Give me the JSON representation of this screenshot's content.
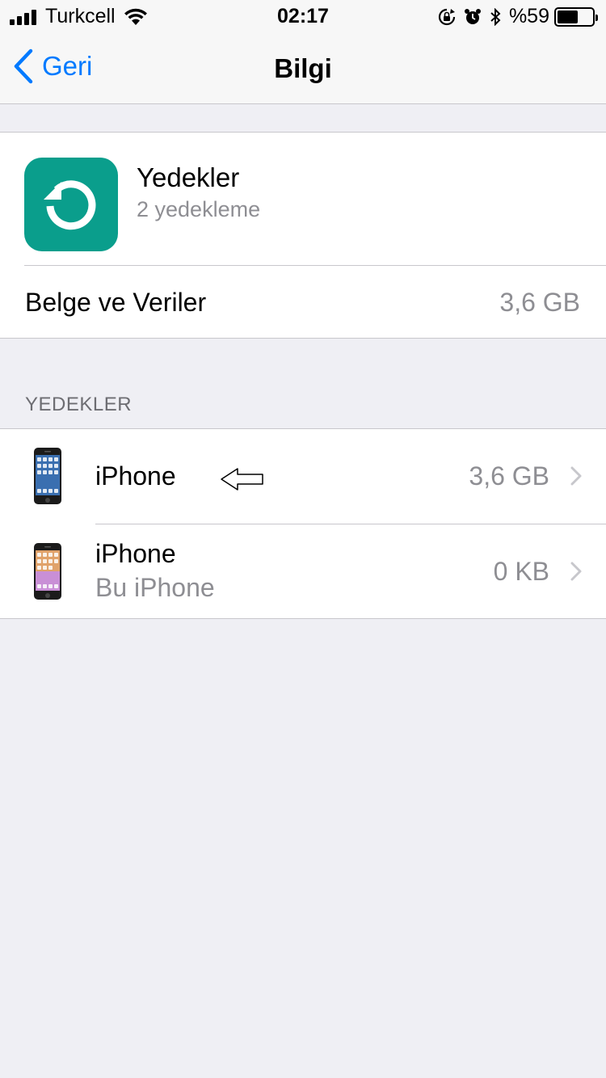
{
  "status_bar": {
    "carrier": "Turkcell",
    "time": "02:17",
    "battery_percent": "%59",
    "battery_level": 0.59,
    "icons": [
      "signal-icon",
      "wifi-icon",
      "rotation-lock-icon",
      "alarm-icon",
      "bluetooth-icon",
      "battery-icon"
    ]
  },
  "nav": {
    "back_label": "Geri",
    "title": "Bilgi"
  },
  "app": {
    "name": "Yedekler",
    "subtitle": "2 yedekleme",
    "icon_color": "#0a9e8c",
    "icon": "backup-restore-icon"
  },
  "docs": {
    "label": "Belge ve Veriler",
    "value": "3,6 GB"
  },
  "backups_section": {
    "header": "YEDEKLER",
    "items": [
      {
        "title": "iPhone",
        "subtitle": "",
        "size": "3,6 GB",
        "icon": "iphone-icon"
      },
      {
        "title": "iPhone",
        "subtitle": "Bu iPhone",
        "size": "0 KB",
        "icon": "iphone-icon"
      }
    ]
  },
  "colors": {
    "accent": "#007aff",
    "background": "#efeff4",
    "secondary_text": "#8e8e93",
    "separator": "#c8c7cc"
  }
}
